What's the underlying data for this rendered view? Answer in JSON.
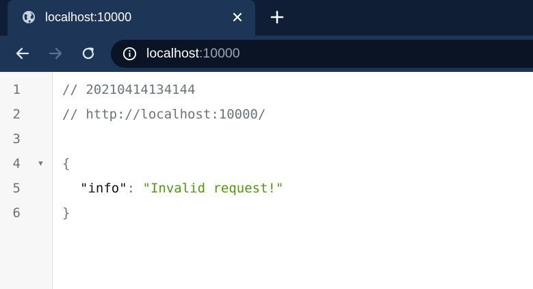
{
  "tab": {
    "title": "localhost:10000",
    "favicon": "globe-icon",
    "close_icon": "close-icon",
    "new_tab_icon": "plus-icon"
  },
  "toolbar": {
    "back_icon": "arrow-left-icon",
    "forward_icon": "arrow-right-icon",
    "reload_icon": "reload-icon",
    "site_info_icon": "info-icon",
    "url_host": "localhost",
    "url_port": ":10000"
  },
  "viewer": {
    "line_numbers": [
      "1",
      "2",
      "3",
      "4",
      "5",
      "6"
    ],
    "fold_icon": "fold-triangle-icon",
    "comment_timestamp": "// 20210414134144",
    "comment_url": "// http://localhost:10000/",
    "open_brace": "{",
    "key": "\"info\"",
    "colon": ": ",
    "value": "\"Invalid request!\"",
    "close_brace": "}"
  },
  "colors": {
    "tab_strip_bg": "#0f1e35",
    "active_tab_bg": "#1d3557",
    "omnibox_bg": "#0b1424",
    "comment": "#6a737d",
    "string": "#4e9a06"
  }
}
